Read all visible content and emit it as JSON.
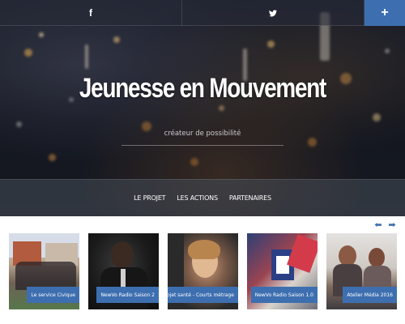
{
  "social": {
    "facebook_icon": "f",
    "twitter_icon": "🐦",
    "plus_icon": "+"
  },
  "hero": {
    "title": "Jeunesse en Mouvement",
    "tagline": "créateur de possibilité"
  },
  "nav": {
    "items": [
      "LE PROJET",
      "LES ACTIONS",
      "PARTENAIRES"
    ]
  },
  "carousel": {
    "prev_icon": "⬅",
    "next_icon": "➡",
    "cards": [
      {
        "caption": "Le service Civique"
      },
      {
        "caption": "NewVo Radio Saison 2"
      },
      {
        "caption": "Projet santé - Courts métrage"
      },
      {
        "caption": "NewVo Radio Saison 1.0"
      },
      {
        "caption": "Atelier Média 2016"
      }
    ]
  },
  "colors": {
    "accent": "#3d6fb0",
    "hero_dark": "#141822"
  }
}
